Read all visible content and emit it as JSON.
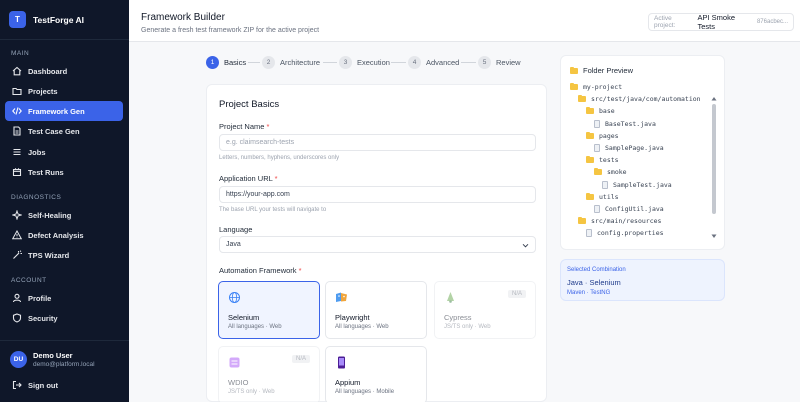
{
  "brand": {
    "logo_letter": "T",
    "name": "TestForge AI"
  },
  "sidebar": {
    "sections": [
      {
        "label": "MAIN",
        "items": [
          {
            "label": "Dashboard",
            "icon": "home-icon"
          },
          {
            "label": "Projects",
            "icon": "folder-icon"
          },
          {
            "label": "Framework Gen",
            "icon": "code-icon",
            "active": true
          },
          {
            "label": "Test Case Gen",
            "icon": "document-icon"
          },
          {
            "label": "Jobs",
            "icon": "list-icon"
          },
          {
            "label": "Test Runs",
            "icon": "calendar-icon"
          }
        ]
      },
      {
        "label": "DIAGNOSTICS",
        "items": [
          {
            "label": "Self-Healing",
            "icon": "sparkle-icon"
          },
          {
            "label": "Defect Analysis",
            "icon": "warning-icon"
          },
          {
            "label": "TPS Wizard",
            "icon": "wand-icon"
          }
        ]
      },
      {
        "label": "ACCOUNT",
        "items": [
          {
            "label": "Profile",
            "icon": "user-icon"
          },
          {
            "label": "Security",
            "icon": "shield-icon"
          }
        ]
      }
    ]
  },
  "user": {
    "initials": "DU",
    "name": "Demo User",
    "email": "demo@platform.local",
    "signout": "Sign out"
  },
  "header": {
    "title": "Framework Builder",
    "subtitle": "Generate a fresh test framework ZIP for the active project",
    "project_label": "Active project:",
    "project_value": "API Smoke Tests",
    "project_id": "876acbec..."
  },
  "steps": [
    {
      "num": "1",
      "label": "Basics",
      "active": true
    },
    {
      "num": "2",
      "label": "Architecture"
    },
    {
      "num": "3",
      "label": "Execution"
    },
    {
      "num": "4",
      "label": "Advanced"
    },
    {
      "num": "5",
      "label": "Review"
    }
  ],
  "form": {
    "title": "Project Basics",
    "project_name": {
      "label": "Project Name",
      "placeholder": "e.g. claimsearch-tests",
      "hint": "Letters, numbers, hyphens, underscores only"
    },
    "app_url": {
      "label": "Application URL",
      "placeholder": "https://your-app.com",
      "hint": "The base URL your tests will navigate to"
    },
    "language": {
      "label": "Language",
      "value": "Java"
    },
    "framework_label": "Automation Framework",
    "frameworks": [
      {
        "name": "Selenium",
        "sub": "All languages · Web",
        "state": "selected",
        "icon": "globe-icon"
      },
      {
        "name": "Playwright",
        "sub": "All languages · Web",
        "state": "normal",
        "icon": "playwright-icon"
      },
      {
        "name": "Cypress",
        "sub": "JS/TS only · Web",
        "state": "disabled",
        "badge": "N/A",
        "icon": "cypress-icon"
      },
      {
        "name": "WDIO",
        "sub": "JS/TS only · Web",
        "state": "disabled",
        "badge": "N/A",
        "icon": "wdio-icon"
      },
      {
        "name": "Appium",
        "sub": "All languages · Mobile",
        "state": "normal",
        "icon": "mobile-icon"
      }
    ]
  },
  "preview": {
    "title": "Folder Preview",
    "tree": [
      {
        "name": "my-project",
        "type": "folder",
        "depth": 0
      },
      {
        "name": "src/test/java/com/automation",
        "type": "folder",
        "depth": 1
      },
      {
        "name": "base",
        "type": "folder",
        "depth": 2
      },
      {
        "name": "BaseTest.java",
        "type": "file",
        "depth": 3
      },
      {
        "name": "pages",
        "type": "folder",
        "depth": 2
      },
      {
        "name": "SamplePage.java",
        "type": "file",
        "depth": 3
      },
      {
        "name": "tests",
        "type": "folder",
        "depth": 2
      },
      {
        "name": "smoke",
        "type": "folder",
        "depth": 3
      },
      {
        "name": "SampleTest.java",
        "type": "file",
        "depth": 4
      },
      {
        "name": "utils",
        "type": "folder",
        "depth": 2
      },
      {
        "name": "ConfigUtil.java",
        "type": "file",
        "depth": 3
      },
      {
        "name": "src/main/resources",
        "type": "folder",
        "depth": 1
      },
      {
        "name": "config.properties",
        "type": "file",
        "depth": 2
      }
    ]
  },
  "combination": {
    "label": "Selected Combination",
    "value": "Java · Selenium",
    "sub": "Maven · TestNG"
  },
  "colors": {
    "accent": "#3b63e8",
    "sidebar_bg": "#0f1729",
    "folder": "#f5c542"
  }
}
